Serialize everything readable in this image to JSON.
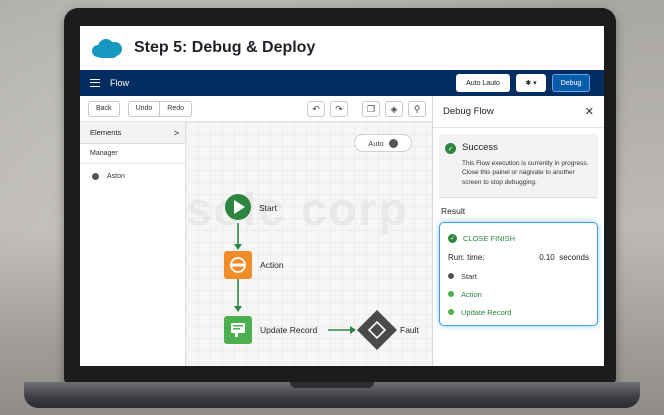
{
  "app": {
    "page_title": "Step 5: Debug & Deploy",
    "nav_title": "Flow",
    "nav_buttons": {
      "auto": "Auto Lauto",
      "debug": "Debug"
    },
    "accent": "#032d60",
    "brand_color": "#1798c1"
  },
  "toolbar": {
    "back": "Back",
    "undo": "Undo",
    "redo": "Redo"
  },
  "sidebar": {
    "header": "Elements",
    "section": "Manager",
    "items": [
      {
        "label": "Aston"
      }
    ]
  },
  "canvas": {
    "watermark": "solc corp",
    "auto_layout": "Auto",
    "nodes": {
      "start": "Start",
      "action": "Action",
      "update": "Update Record",
      "fault": "Fault"
    },
    "colors": {
      "start": "#2e8540",
      "action": "#f28c28",
      "update": "#4caf50",
      "fault": "#4a4a4a"
    }
  },
  "debug_panel": {
    "title": "Debug Flow",
    "status_title": "Success",
    "status_text": "This Flow execution is currently in progress. Close this painel or nagivate to another screen to stop debugging.",
    "result_label": "Result",
    "result": {
      "headline": "CLOSE FINISH",
      "runtime_label": "Run: time:",
      "runtime_value": "0.10  seconds",
      "steps": [
        {
          "label": "Start",
          "status": "neutral"
        },
        {
          "label": "Action",
          "status": "success"
        },
        {
          "label": "Update Record",
          "status": "success"
        }
      ]
    }
  }
}
